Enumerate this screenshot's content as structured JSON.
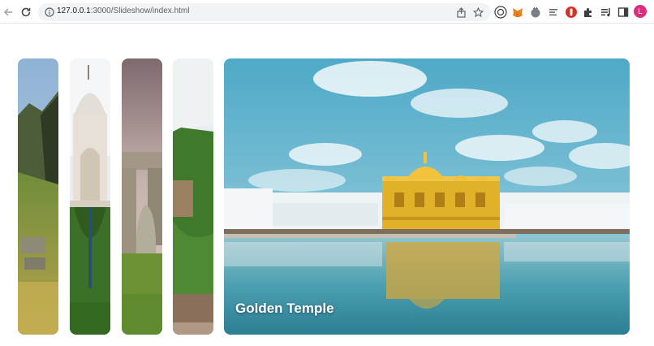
{
  "browser": {
    "url_host": "127.0.0.1",
    "url_path": ":3000/Slideshow/index.html",
    "profile_initial": "L",
    "icons": [
      "back-arrow-icon",
      "reload-icon",
      "site-info-icon",
      "share-icon",
      "bookmark-star-icon",
      "ext-1-icon",
      "metamask-fox-icon",
      "ext-3-icon",
      "ext-4-icon",
      "ext-red-icon",
      "extensions-puzzle-icon",
      "media-queue-icon",
      "side-panel-icon"
    ]
  },
  "slideshow": {
    "slides": [
      {
        "subject": "mountain-ruins",
        "active": false
      },
      {
        "subject": "white-marble-mausoleum",
        "active": false
      },
      {
        "subject": "standing-stones",
        "active": false
      },
      {
        "subject": "green-hillside",
        "active": false
      },
      {
        "subject": "golden-temple",
        "active": true,
        "caption": "Golden Temple"
      }
    ]
  },
  "colors": {
    "sky": "#5fb3cc",
    "gold": "#e2b12a",
    "water": "#3f95a6",
    "profile": "#d92f7a"
  }
}
